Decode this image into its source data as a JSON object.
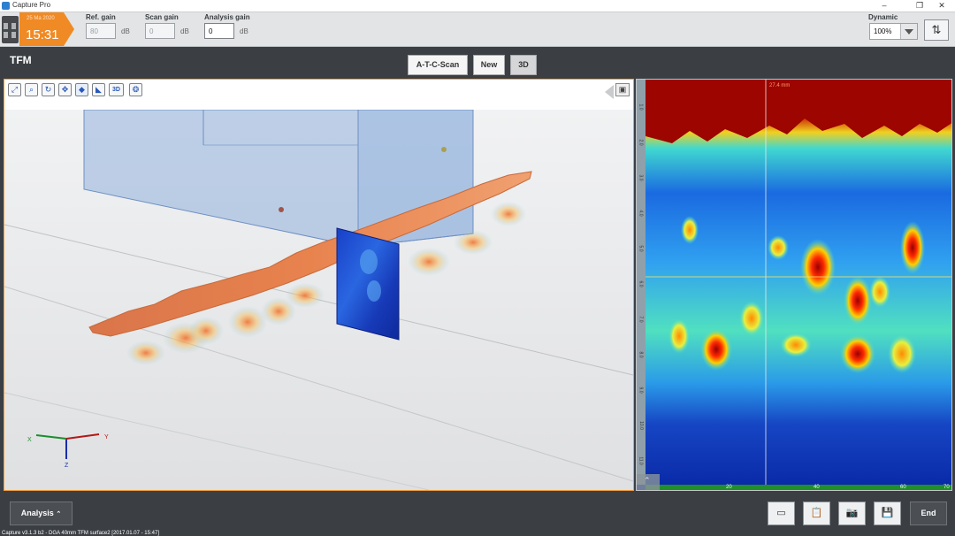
{
  "window": {
    "title": "Capture Pro"
  },
  "clock": {
    "date": "25 Ma 2020",
    "time": "15:31"
  },
  "gains": {
    "ref": {
      "label": "Ref. gain",
      "value": "80",
      "unit": "dB"
    },
    "scan": {
      "label": "Scan gain",
      "value": "0",
      "unit": "dB"
    },
    "analysis": {
      "label": "Analysis gain",
      "value": "0",
      "unit": "dB"
    }
  },
  "dynamic": {
    "label": "Dynamic",
    "value": "100%"
  },
  "mode": {
    "title": "TFM"
  },
  "tabs": [
    {
      "label": "A-T-C-Scan"
    },
    {
      "label": "New"
    },
    {
      "label": "3D"
    }
  ],
  "toolbar3d": {
    "icons": [
      "fit-icon",
      "zoom-icon",
      "rotate-icon",
      "pan-icon",
      "probe-icon",
      "probe-alt-icon",
      "view-3d-icon",
      "layers-icon"
    ],
    "view3d_label": "3D"
  },
  "axes": {
    "x": "X",
    "y": "Y",
    "z": "Z"
  },
  "bscan": {
    "readout": "27.4 mm",
    "x_ticks": [
      "20",
      "40",
      "60",
      "70"
    ],
    "y_ticks": [
      "1.0",
      "2.0",
      "3.0",
      "4.0",
      "5.0",
      "6.0",
      "7.0",
      "8.0",
      "9.0",
      "10.0",
      "11.0"
    ]
  },
  "bottom": {
    "analysis_label": "Analysis",
    "end_label": "End",
    "status": "Capture v3.1.3 b2 - DGA 40mm TFM  surface2 [2017.01.07 - 15:47]"
  },
  "colors": {
    "accent": "#f08a24",
    "frame": "#f0a040",
    "background": "#3b3f44"
  }
}
